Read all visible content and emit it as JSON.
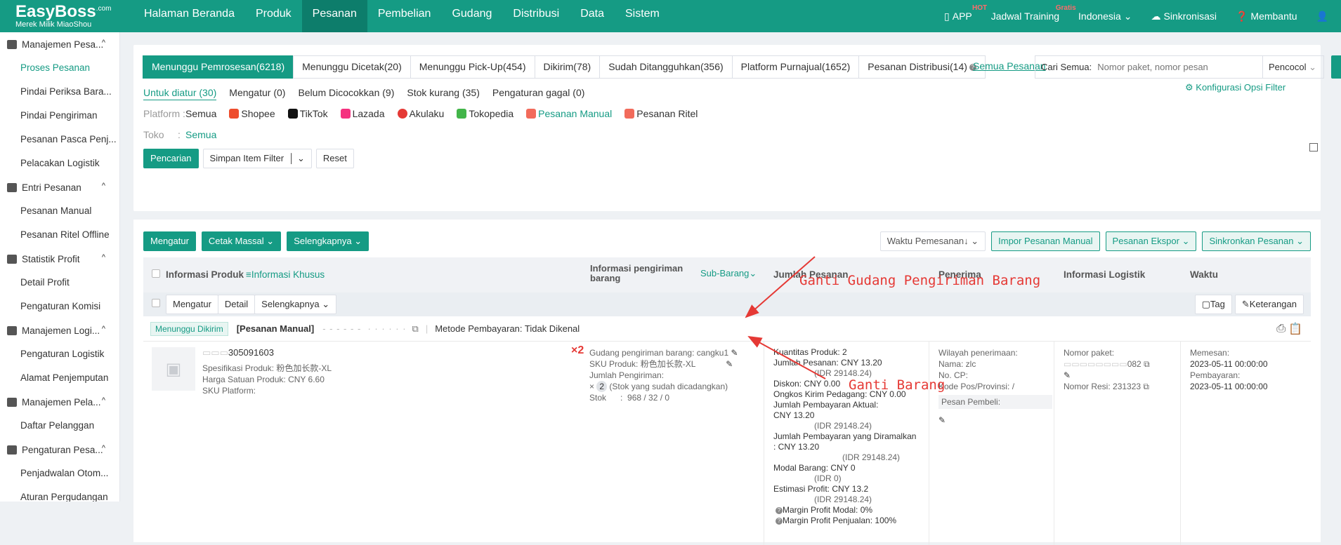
{
  "brand": {
    "name": "EasyBoss",
    "sup": ".com",
    "tagline": "Merek Milik MiaoShou"
  },
  "nav": [
    "Halaman Beranda",
    "Produk",
    "Pesanan",
    "Pembelian",
    "Gudang",
    "Distribusi",
    "Data",
    "Sistem"
  ],
  "topright": {
    "app": "APP",
    "app_badge": "HOT",
    "training": "Jadwal Training",
    "training_badge": "Gratis",
    "language": "Indonesia",
    "sync": "Sinkronisasi",
    "help": "Membantu"
  },
  "sidebar": [
    {
      "group": "Manajemen Pesa...",
      "items": [
        "Proses Pesanan",
        "Pindai Periksa Bara...",
        "Pindai Pengiriman",
        "Pesanan Pasca Penj...",
        "Pelacakan Logistik"
      ]
    },
    {
      "group": "Entri Pesanan",
      "items": [
        "Pesanan Manual",
        "Pesanan Ritel Offline"
      ]
    },
    {
      "group": "Statistik Profit",
      "items": [
        "Detail Profit",
        "Pengaturan Komisi"
      ]
    },
    {
      "group": "Manajemen Logi...",
      "items": [
        "Pengaturan Logistik",
        "Alamat Penjemputan"
      ]
    },
    {
      "group": "Manajemen Pela...",
      "items": [
        "Daftar Pelanggan"
      ]
    },
    {
      "group": "Pengaturan Pesa...",
      "items": [
        "Penjadwalan Otom...",
        "Aturan Pergudangan"
      ]
    }
  ],
  "tabs": [
    "Menunggu Pemrosesan(6218)",
    "Menunggu Dicetak(20)",
    "Menunggu Pick-Up(454)",
    "Dikirim(78)",
    "Sudah Ditangguhkan(356)",
    "Platform Purnajual(1652)",
    "Pesanan Distribusi(14)"
  ],
  "all_orders": "Semua Pesanan",
  "search": {
    "label": "Cari Semua:",
    "placeholder": "Nomor paket, nomor pesan",
    "select": "Pencocol"
  },
  "config_filter": "Konfigurasi Opsi Filter",
  "subtabs": [
    "Untuk diatur (30)",
    "Mengatur (0)",
    "Belum Dicocokkan (9)",
    "Stok kurang (35)",
    "Pengaturan gagal (0)"
  ],
  "platform_label": "Platform",
  "platforms": [
    "Semua",
    "Shopee",
    "TikTok",
    "Lazada",
    "Akulaku",
    "Tokopedia",
    "Pesanan Manual",
    "Pesanan Ritel"
  ],
  "toko_label": "Toko",
  "toko_value": "Semua",
  "filter_buttons": {
    "search": "Pencarian",
    "save": "Simpan Item Filter",
    "reset": "Reset"
  },
  "toolbar": {
    "arrange": "Mengatur",
    "print": "Cetak Massal",
    "more": "Selengkapnya",
    "time": "Waktu Pemesanan",
    "import": "Impor Pesanan Manual",
    "export": "Pesanan Ekspor",
    "sync": "Sinkronkan Pesanan"
  },
  "table_headers": {
    "product": "Informasi Produk",
    "special": "Informasi Khusus",
    "shipping": "Informasi pengiriman barang",
    "subitem": "Sub-Barang",
    "amount": "Jumlah Pesanan",
    "receiver": "Penerima",
    "logistics": "Informasi Logistik",
    "time": "Waktu"
  },
  "row_actions": {
    "arrange": "Mengatur",
    "detail": "Detail",
    "more": "Selengkapnya",
    "tag": "Tag",
    "note": "Keterangan"
  },
  "order": {
    "status": "Menunggu Dikirim",
    "type": "[Pesanan Manual]",
    "payment": "Metode Pembayaran: Tidak Dikenal",
    "product_id": "305091603",
    "spec": "Spesifikasi Produk:  粉色加长款-XL",
    "unit_price": "Harga Satuan Produk:  CNY 6.60",
    "platform_sku": "SKU Platform:",
    "qty_mark": "×2",
    "warehouse": "Gudang pengiriman barang:  cangku1",
    "sku": "SKU Produk:  粉色加长款-XL",
    "ship_qty": "Jumlah Pengiriman:",
    "ship_qty_val": "2",
    "ship_qty_note": "(Stok yang sudah dicadangkan)",
    "stock": "Stok      :  968 / 32 / 0",
    "amounts": [
      "Kuantitas Produk:  2",
      "Jumlah Pesanan:  CNY 13.20",
      "(IDR 29148.24)",
      "Diskon:  CNY 0.00",
      "Ongkos Kirim Pedagang:  CNY 0.00",
      "Jumlah Pembayaran Aktual:",
      "CNY 13.20",
      "(IDR 29148.24)",
      "Jumlah Pembayaran yang Diramalkan",
      ":  CNY 13.20",
      "(IDR 29148.24)",
      "Modal Barang:  CNY 0",
      "(IDR 0)",
      "Estimasi Profit:  CNY 13.2",
      "(IDR 29148.24)",
      "Margin Profit Modal:  0%",
      "Margin Profit Penjualan:  100%"
    ],
    "receiver": [
      "Wilayah penerimaan:",
      "Nama:  zlc",
      "No. CP:",
      "Kode Pos/Provinsi:  /"
    ],
    "buyer_msg": "Pesan Pembeli:",
    "package_label": "Nomor paket:",
    "package_val": "082",
    "resi": "Nomor Resi:  231323",
    "order_time_label": "Memesan:",
    "order_time": "2023-05-11 00:00:00",
    "pay_time_label": "Pembayaran:",
    "pay_time": "2023-05-11 00:00:00"
  },
  "annotations": {
    "change_warehouse": "Ganti Gudang Pengiriman Barang",
    "change_item": "Ganti Barang"
  }
}
